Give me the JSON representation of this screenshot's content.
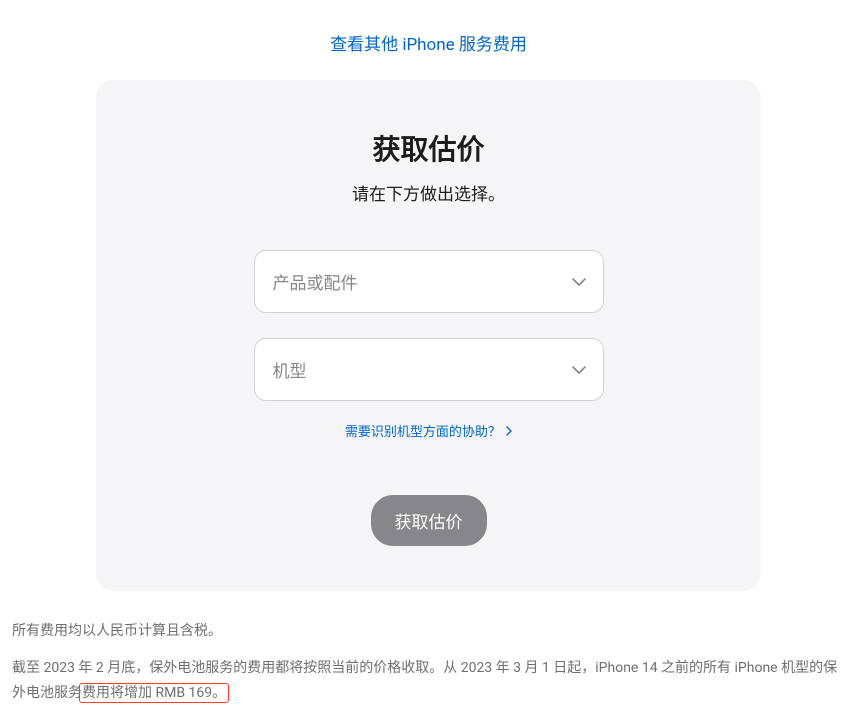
{
  "topLink": {
    "text": "查看其他 iPhone 服务费用"
  },
  "card": {
    "title": "获取估价",
    "subtitle": "请在下方做出选择。",
    "selectProduct": {
      "placeholder": "产品或配件"
    },
    "selectModel": {
      "placeholder": "机型"
    },
    "helpLink": {
      "text": "需要识别机型方面的协助？"
    },
    "button": {
      "label": "获取估价"
    }
  },
  "footer": {
    "line1": "所有费用均以人民币计算且含税。",
    "line2_part1": "截至 2023 年 2 月底，保外电池服务的费用都将按照当前的价格收取。从 2023 年 3 月 1 日起，iPhone 14 之前的所有 iPhone 机型的保外电池服务",
    "line2_highlight": "费用将增加 RMB 169。"
  }
}
